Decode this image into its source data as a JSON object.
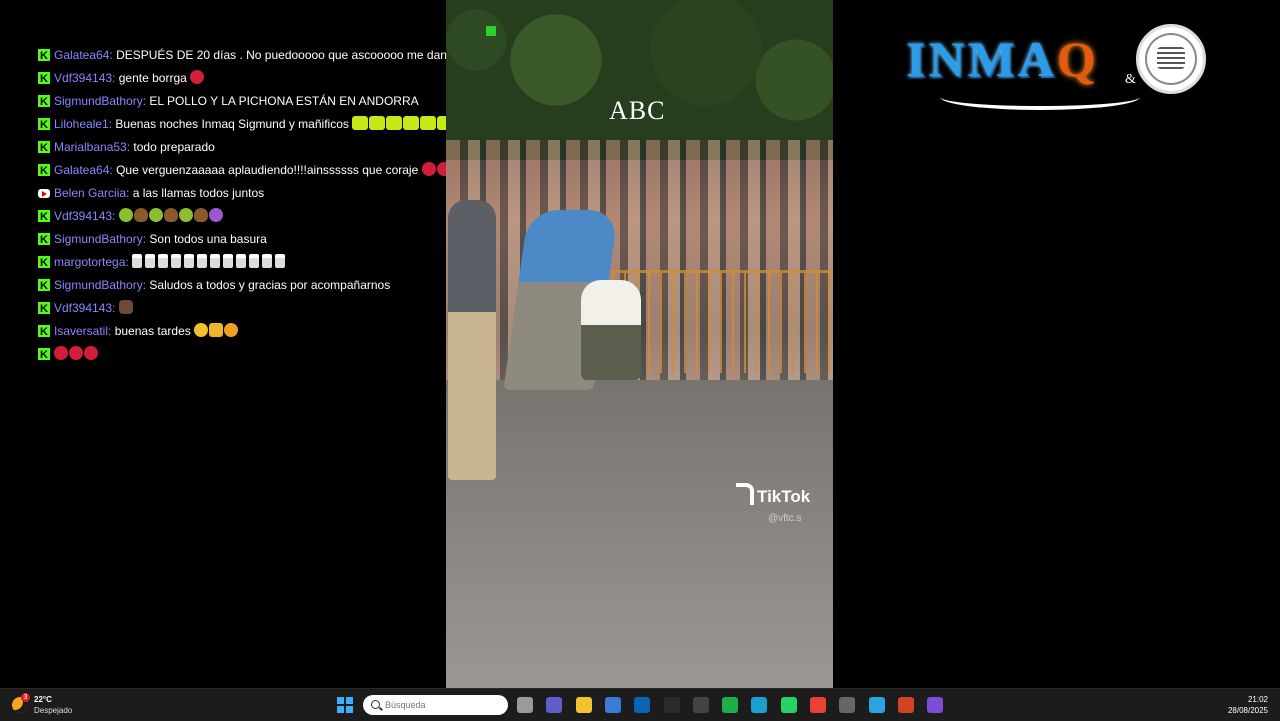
{
  "chat": {
    "messages": [
      {
        "platform": "kick",
        "user": "Galatea64:",
        "text": "DESPUÉS DE 20 días . No puedooooo que ascooooo me dan todos",
        "emotes": []
      },
      {
        "platform": "kick",
        "user": "Vdf394143:",
        "text": "gente borrga",
        "emotes": [
          "red"
        ]
      },
      {
        "platform": "kick",
        "user": "SigmundBathory:",
        "text": "EL POLLO Y LA PICHONA ESTÁN EN ANDORRA",
        "emotes": []
      },
      {
        "platform": "kick",
        "user": "Liloheale1:",
        "text": "Buenas noches Inmaq Sigmund y mañificos",
        "emotes": [
          "green",
          "green",
          "green",
          "green",
          "green",
          "green",
          "green"
        ]
      },
      {
        "platform": "kick",
        "user": "Marialbana53:",
        "text": "todo preparado",
        "emotes": []
      },
      {
        "platform": "kick",
        "user": "Galatea64:",
        "text": "Que verguenzaaaaa aplaudiendo!!!!ainssssss que coraje",
        "emotes": [
          "red",
          "red",
          "red",
          "red",
          "red"
        ]
      },
      {
        "platform": "youtube",
        "user": "Belen Garciia:",
        "text": "a las llamas todos juntos",
        "emotes": []
      },
      {
        "platform": "kick",
        "user": "Vdf394143:",
        "text": "",
        "emotes": [
          "sick",
          "poop",
          "sick",
          "poop",
          "sick",
          "poop",
          "devil"
        ]
      },
      {
        "platform": "kick",
        "user": "SigmundBathory:",
        "text": "Son todos una basura",
        "emotes": []
      },
      {
        "platform": "kick",
        "user": "margotortega:",
        "text": "",
        "emotes": [
          "cand",
          "cand",
          "cand",
          "cand",
          "cand",
          "cand",
          "cand",
          "cand",
          "cand",
          "cand",
          "cand",
          "cand"
        ]
      },
      {
        "platform": "kick",
        "user": "SigmundBathory:",
        "text": "Saludos a todos y gracias por acompañarnos",
        "emotes": []
      },
      {
        "platform": "kick",
        "user": "Vdf394143:",
        "text": "",
        "emotes": [
          "cat"
        ]
      },
      {
        "platform": "kick",
        "user": "Isaversatil:",
        "text": "buenas tardes",
        "emotes": [
          "smile",
          "thumb",
          "kiss"
        ]
      },
      {
        "platform": "kick",
        "user": "",
        "text": "",
        "emotes": [
          "red",
          "red",
          "red"
        ]
      }
    ]
  },
  "video": {
    "watermark": "ABC",
    "tiktok_label": "TikTok",
    "tiktok_user": "@vftc.s"
  },
  "brand": {
    "name_main": "INMA",
    "name_q": "Q",
    "amp": "&"
  },
  "taskbar": {
    "weather_temp": "22°C",
    "weather_desc": "Despejado",
    "weather_badge": "3",
    "search_placeholder": "Búsqueda",
    "time": "21:02",
    "date": "28/08/2025",
    "apps": [
      {
        "name": "task-view-icon",
        "color": "#9a9a9a"
      },
      {
        "name": "teams-icon",
        "color": "#5b5fc7"
      },
      {
        "name": "file-explorer-icon",
        "color": "#f2c230"
      },
      {
        "name": "store-icon",
        "color": "#3a7bd5"
      },
      {
        "name": "outlook-icon",
        "color": "#0a64b4"
      },
      {
        "name": "chrome-ext-icon",
        "color": "#2a2a2a"
      },
      {
        "name": "obs-icon",
        "color": "#444444"
      },
      {
        "name": "camtasia-icon",
        "color": "#1fae4a"
      },
      {
        "name": "edge-icon",
        "color": "#1a9fd1"
      },
      {
        "name": "whatsapp-icon",
        "color": "#25d366"
      },
      {
        "name": "chrome-icon",
        "color": "#e94235"
      },
      {
        "name": "vpn-icon",
        "color": "#666666"
      },
      {
        "name": "telegram-icon",
        "color": "#2aa3e0"
      },
      {
        "name": "powerpoint-icon",
        "color": "#d04423"
      },
      {
        "name": "app-circle-icon",
        "color": "#7b4dd6"
      }
    ]
  }
}
